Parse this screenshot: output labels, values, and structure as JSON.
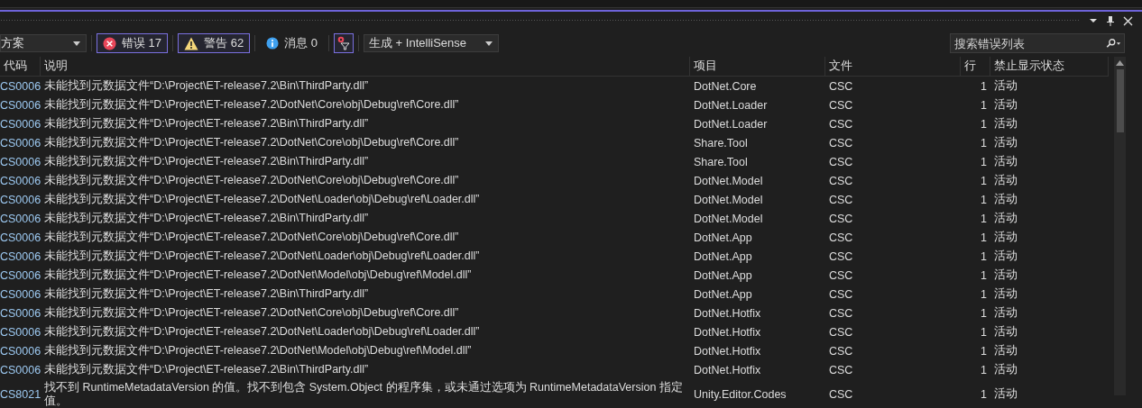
{
  "toolbar": {
    "scope": "方案",
    "filters": [
      {
        "kind": "error",
        "label": "错误 17",
        "selected": true
      },
      {
        "kind": "warning",
        "label": "警告 62",
        "selected": true
      },
      {
        "kind": "info",
        "label": "消息 0",
        "selected": false
      }
    ],
    "filter_toggle": {
      "selected": true
    },
    "source": "生成 + IntelliSense",
    "search": {
      "placeholder": "搜索错误列表"
    }
  },
  "table": {
    "columns": [
      "代码",
      "说明",
      "项目",
      "文件",
      "行",
      "禁止显示状态"
    ],
    "rows": [
      {
        "code": "CS0006",
        "description": "未能找到元数据文件“D:\\Project\\ET-release7.2\\Bin\\ThirdParty.dll”",
        "project": "DotNet.Core",
        "file": "CSC",
        "line": "1",
        "state": "活动"
      },
      {
        "code": "CS0006",
        "description": "未能找到元数据文件“D:\\Project\\ET-release7.2\\DotNet\\Core\\obj\\Debug\\ref\\Core.dll”",
        "project": "DotNet.Loader",
        "file": "CSC",
        "line": "1",
        "state": "活动"
      },
      {
        "code": "CS0006",
        "description": "未能找到元数据文件“D:\\Project\\ET-release7.2\\Bin\\ThirdParty.dll”",
        "project": "DotNet.Loader",
        "file": "CSC",
        "line": "1",
        "state": "活动"
      },
      {
        "code": "CS0006",
        "description": "未能找到元数据文件“D:\\Project\\ET-release7.2\\DotNet\\Core\\obj\\Debug\\ref\\Core.dll”",
        "project": "Share.Tool",
        "file": "CSC",
        "line": "1",
        "state": "活动"
      },
      {
        "code": "CS0006",
        "description": "未能找到元数据文件“D:\\Project\\ET-release7.2\\Bin\\ThirdParty.dll”",
        "project": "Share.Tool",
        "file": "CSC",
        "line": "1",
        "state": "活动"
      },
      {
        "code": "CS0006",
        "description": "未能找到元数据文件“D:\\Project\\ET-release7.2\\DotNet\\Core\\obj\\Debug\\ref\\Core.dll”",
        "project": "DotNet.Model",
        "file": "CSC",
        "line": "1",
        "state": "活动"
      },
      {
        "code": "CS0006",
        "description": "未能找到元数据文件“D:\\Project\\ET-release7.2\\DotNet\\Loader\\obj\\Debug\\ref\\Loader.dll”",
        "project": "DotNet.Model",
        "file": "CSC",
        "line": "1",
        "state": "活动"
      },
      {
        "code": "CS0006",
        "description": "未能找到元数据文件“D:\\Project\\ET-release7.2\\Bin\\ThirdParty.dll”",
        "project": "DotNet.Model",
        "file": "CSC",
        "line": "1",
        "state": "活动"
      },
      {
        "code": "CS0006",
        "description": "未能找到元数据文件“D:\\Project\\ET-release7.2\\DotNet\\Core\\obj\\Debug\\ref\\Core.dll”",
        "project": "DotNet.App",
        "file": "CSC",
        "line": "1",
        "state": "活动"
      },
      {
        "code": "CS0006",
        "description": "未能找到元数据文件“D:\\Project\\ET-release7.2\\DotNet\\Loader\\obj\\Debug\\ref\\Loader.dll”",
        "project": "DotNet.App",
        "file": "CSC",
        "line": "1",
        "state": "活动"
      },
      {
        "code": "CS0006",
        "description": "未能找到元数据文件“D:\\Project\\ET-release7.2\\DotNet\\Model\\obj\\Debug\\ref\\Model.dll”",
        "project": "DotNet.App",
        "file": "CSC",
        "line": "1",
        "state": "活动"
      },
      {
        "code": "CS0006",
        "description": "未能找到元数据文件“D:\\Project\\ET-release7.2\\Bin\\ThirdParty.dll”",
        "project": "DotNet.App",
        "file": "CSC",
        "line": "1",
        "state": "活动"
      },
      {
        "code": "CS0006",
        "description": "未能找到元数据文件“D:\\Project\\ET-release7.2\\DotNet\\Core\\obj\\Debug\\ref\\Core.dll”",
        "project": "DotNet.Hotfix",
        "file": "CSC",
        "line": "1",
        "state": "活动"
      },
      {
        "code": "CS0006",
        "description": "未能找到元数据文件“D:\\Project\\ET-release7.2\\DotNet\\Loader\\obj\\Debug\\ref\\Loader.dll”",
        "project": "DotNet.Hotfix",
        "file": "CSC",
        "line": "1",
        "state": "活动"
      },
      {
        "code": "CS0006",
        "description": "未能找到元数据文件“D:\\Project\\ET-release7.2\\DotNet\\Model\\obj\\Debug\\ref\\Model.dll”",
        "project": "DotNet.Hotfix",
        "file": "CSC",
        "line": "1",
        "state": "活动"
      },
      {
        "code": "CS0006",
        "description": "未能找到元数据文件“D:\\Project\\ET-release7.2\\Bin\\ThirdParty.dll”",
        "project": "DotNet.Hotfix",
        "file": "CSC",
        "line": "1",
        "state": "活动"
      },
      {
        "code": "CS8021",
        "description": "找不到 RuntimeMetadataVersion 的值。找不到包含 System.Object 的程序集，或未通过选项为 RuntimeMetadataVersion 指定值。",
        "project": "Unity.Editor.Codes",
        "file": "CSC",
        "line": "1",
        "state": "活动"
      }
    ]
  }
}
